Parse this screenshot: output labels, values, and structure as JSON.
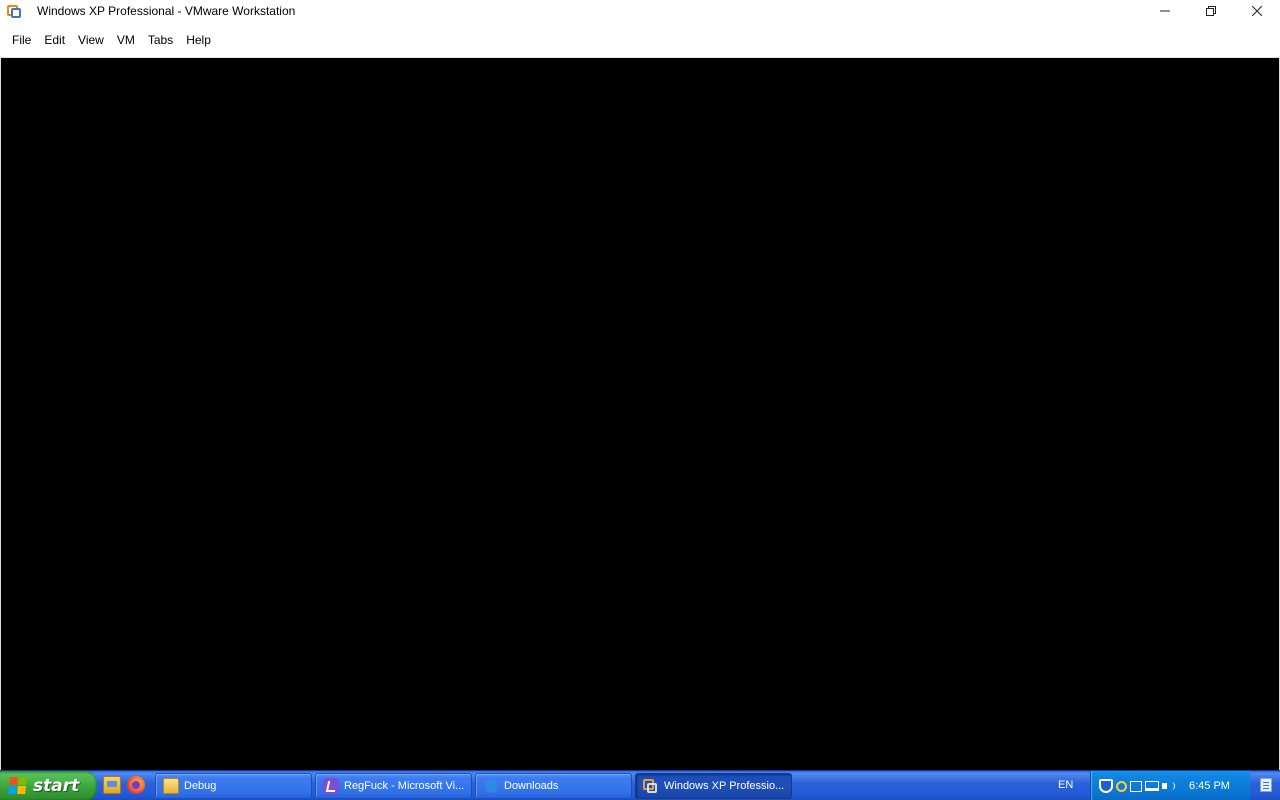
{
  "window": {
    "title": "Windows XP Professional - VMware Workstation",
    "icon": "vmware-workstation-icon",
    "controls": [
      "minimize",
      "restore",
      "close"
    ]
  },
  "menubar": {
    "items": [
      "File",
      "Edit",
      "View",
      "VM",
      "Tabs",
      "Help"
    ]
  },
  "vm_screen": {
    "background": "#000000"
  },
  "taskbar": {
    "start_label": "start",
    "quick_launch": [
      "file-explorer-icon",
      "firefox-icon"
    ],
    "tasks": [
      {
        "label": "Debug",
        "icon": "folder-icon",
        "active": false
      },
      {
        "label": "RegFuck - Microsoft Vi...",
        "icon": "visual-studio-icon",
        "active": false
      },
      {
        "label": "Downloads",
        "icon": "downloads-icon",
        "active": false
      },
      {
        "label": "Windows XP Professio...",
        "icon": "vmware-workstation-icon",
        "active": true
      }
    ],
    "language": "EN",
    "tray_icons": [
      "security-shield-icon",
      "magnifier-icon",
      "window-icon",
      "network-icon",
      "volume-icon"
    ],
    "clock": "6:45 PM",
    "notification_icon": "notification-icon"
  },
  "colors": {
    "taskbar_blue": "#245edb",
    "start_green": "#3fa83f",
    "tray_blue": "#0b73d0"
  }
}
